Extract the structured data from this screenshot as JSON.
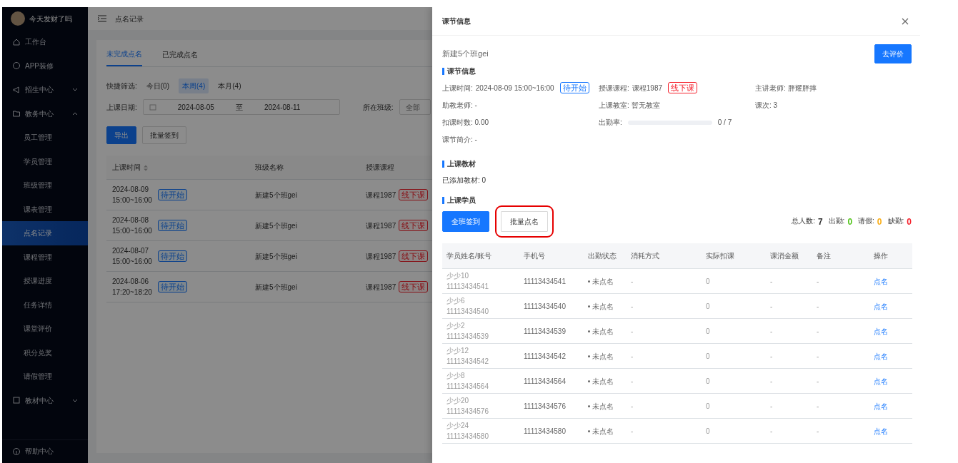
{
  "user": {
    "name": "今天发财了吗"
  },
  "sidebar": {
    "items": [
      {
        "label": "工作台",
        "kind": "link"
      },
      {
        "label": "APP装修",
        "kind": "link"
      },
      {
        "label": "招生中心",
        "kind": "group",
        "expanded": false
      },
      {
        "label": "教务中心",
        "kind": "group",
        "expanded": true,
        "children": [
          {
            "label": "员工管理",
            "selected": false
          },
          {
            "label": "学员管理",
            "selected": false
          },
          {
            "label": "班级管理",
            "selected": false
          },
          {
            "label": "课表管理",
            "selected": false
          },
          {
            "label": "点名记录",
            "selected": true
          },
          {
            "label": "课程管理",
            "selected": false
          },
          {
            "label": "授课进度",
            "selected": false
          },
          {
            "label": "任务详情",
            "selected": false
          },
          {
            "label": "课堂评价",
            "selected": false
          },
          {
            "label": "积分兑奖",
            "selected": false
          },
          {
            "label": "请假管理",
            "selected": false
          }
        ]
      },
      {
        "label": "教材中心",
        "kind": "group",
        "expanded": false
      }
    ],
    "help": "帮助中心"
  },
  "header": {
    "title": "点名记录"
  },
  "tabs": [
    {
      "label": "未完成点名",
      "selected": true
    },
    {
      "label": "已完成点名",
      "selected": false
    }
  ],
  "quick_filter": {
    "label": "快捷筛选:",
    "options": [
      {
        "label": "今日(0)",
        "selected": false
      },
      {
        "label": "本周(4)",
        "selected": true
      },
      {
        "label": "本月(4)",
        "selected": false
      }
    ]
  },
  "date_filter": {
    "label": "上课日期:",
    "start": "2024-08-05",
    "separator": "至",
    "end": "2024-08-11"
  },
  "class_filter": {
    "label": "所在班级:",
    "placeholder": "全部"
  },
  "actions": [
    {
      "label": "导出",
      "kind": "primary"
    },
    {
      "label": "批量签到",
      "kind": "default"
    }
  ],
  "table": {
    "columns": [
      "上课时间",
      "班级名称",
      "授课课程"
    ],
    "rows": [
      {
        "date": "2024-08-09",
        "time": "15:00~16:00",
        "status": "待开始",
        "class": "新建5个班gei",
        "course": "课程1987",
        "mode": "线下课"
      },
      {
        "date": "2024-08-08",
        "time": "15:00~16:00",
        "status": "待开始",
        "class": "新建5个班gei",
        "course": "课程1987",
        "mode": "线下课"
      },
      {
        "date": "2024-08-07",
        "time": "15:00~16:00",
        "status": "待开始",
        "class": "新建5个班gei",
        "course": "课程1987",
        "mode": "线下课"
      },
      {
        "date": "2024-08-06",
        "time": "17:20~18:20",
        "status": "待开始",
        "class": "新建5个班gei",
        "course": "课程1987",
        "mode": "线下课"
      }
    ]
  },
  "drawer": {
    "title": "课节信息",
    "class_name": "新建5个班gei",
    "evaluate_button": "去评价",
    "info_section": "课节信息",
    "fields": [
      {
        "label": "上课时间:",
        "value": "2024-08-09 15:00~16:00",
        "tag": {
          "text": "待开始",
          "color": "#1677ff"
        }
      },
      {
        "label": "授课课程:",
        "value": "课程1987",
        "tag": {
          "text": "线下课",
          "color": "#f5222d"
        }
      },
      {
        "text": "主讲老师: 胖耀胖摔"
      },
      {
        "text": "助教老师: -"
      },
      {
        "text": "上课教室: 暂无教室"
      },
      {
        "text": "课次: 3"
      },
      {
        "text": "扣课时数: 0.00"
      },
      {
        "label": "出勤率:",
        "level": 0,
        "value": "0 / 7"
      },
      {
        "text": "课节简介: -"
      }
    ],
    "material_section": "上课教材",
    "material_text": "已添加教材: 0",
    "student_section": "上课学员",
    "buttons": [
      {
        "label": "全班签到",
        "kind": "primary",
        "highlighted": false
      },
      {
        "label": "批量点名",
        "kind": "default",
        "highlighted": true
      }
    ],
    "stats": [
      {
        "label": "总人数:",
        "value": "7",
        "color": "#333333"
      },
      {
        "label": "出勤:",
        "value": "0",
        "color": "#52c41a"
      },
      {
        "label": "请假:",
        "value": "0",
        "color": "#faad14"
      },
      {
        "label": "缺勤:",
        "value": "0",
        "color": "#f5222d"
      }
    ],
    "columns": [
      "学员姓名/账号",
      "手机号",
      "出勤状态",
      "消耗方式",
      "实际扣课",
      "课消金额",
      "备注",
      "操作"
    ],
    "students": [
      {
        "name": "少少10",
        "account": "11113434541",
        "phone": "11113434541",
        "status": "未点名",
        "consume": "-",
        "deducted": "0",
        "amount": "-",
        "note": "-",
        "action": "点名"
      },
      {
        "name": "少少6",
        "account": "11113434540",
        "phone": "11113434540",
        "status": "未点名",
        "consume": "-",
        "deducted": "0",
        "amount": "-",
        "note": "-",
        "action": "点名"
      },
      {
        "name": "少少2",
        "account": "11113434539",
        "phone": "11113434539",
        "status": "未点名",
        "consume": "-",
        "deducted": "0",
        "amount": "-",
        "note": "-",
        "action": "点名"
      },
      {
        "name": "少少12",
        "account": "11113434542",
        "phone": "11113434542",
        "status": "未点名",
        "consume": "-",
        "deducted": "0",
        "amount": "-",
        "note": "-",
        "action": "点名"
      },
      {
        "name": "少少8",
        "account": "11113434564",
        "phone": "11113434564",
        "status": "未点名",
        "consume": "-",
        "deducted": "0",
        "amount": "-",
        "note": "-",
        "action": "点名"
      },
      {
        "name": "少少20",
        "account": "11113434576",
        "phone": "11113434576",
        "status": "未点名",
        "consume": "-",
        "deducted": "0",
        "amount": "-",
        "note": "-",
        "action": "点名"
      },
      {
        "name": "少少24",
        "account": "11113434580",
        "phone": "11113434580",
        "status": "未点名",
        "consume": "-",
        "deducted": "0",
        "amount": "-",
        "note": "-",
        "action": "点名"
      }
    ]
  }
}
